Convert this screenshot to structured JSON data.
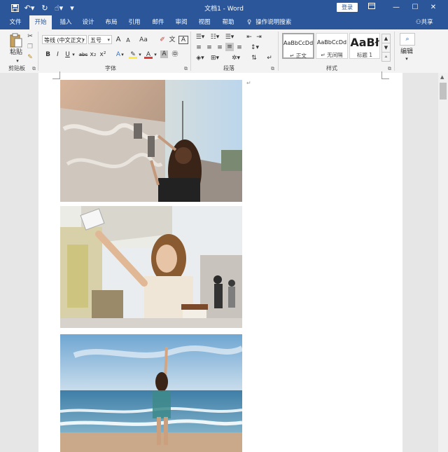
{
  "window": {
    "title": "文档1 - Word",
    "login_label": "登录",
    "minimize_icon": "minimize-icon",
    "maximize_icon": "maximize-icon",
    "close_icon": "close-icon"
  },
  "tabs": [
    {
      "label": "文件",
      "active": false
    },
    {
      "label": "开始",
      "active": true
    },
    {
      "label": "插入",
      "active": false
    },
    {
      "label": "设计",
      "active": false
    },
    {
      "label": "布局",
      "active": false
    },
    {
      "label": "引用",
      "active": false
    },
    {
      "label": "邮件",
      "active": false
    },
    {
      "label": "审阅",
      "active": false
    },
    {
      "label": "视图",
      "active": false
    },
    {
      "label": "帮助",
      "active": false
    }
  ],
  "tellme": "操作说明搜索",
  "share": "共享",
  "clipboard": {
    "paste_label": "粘贴",
    "group_label": "剪贴板"
  },
  "font": {
    "font_name": "等线 (中文正文)",
    "font_size": "五号",
    "group_label": "字体",
    "bold": "B",
    "italic": "I",
    "underline": "U",
    "strike": "abc",
    "subscript": "x₂",
    "superscript": "x²",
    "grow": "A",
    "shrink": "A",
    "case": "Aa"
  },
  "paragraph": {
    "group_label": "段落"
  },
  "styles": {
    "group_label": "样式",
    "items": [
      {
        "preview": "AaBbCcDd",
        "name": "↵ 正文"
      },
      {
        "preview": "AaBbCcDd",
        "name": "↵ 无间隔"
      },
      {
        "preview": "AaBł",
        "name": "标题 1"
      }
    ]
  },
  "editing": {
    "label": "编辑"
  },
  "document": {
    "paragraph_mark": "↵",
    "images": [
      "street-photo",
      "selfie-photo",
      "beach-photo"
    ]
  },
  "colors": {
    "brand": "#2b579a",
    "ribbon_bg": "#f3f3f3",
    "workspace": "#e6e6e6"
  }
}
